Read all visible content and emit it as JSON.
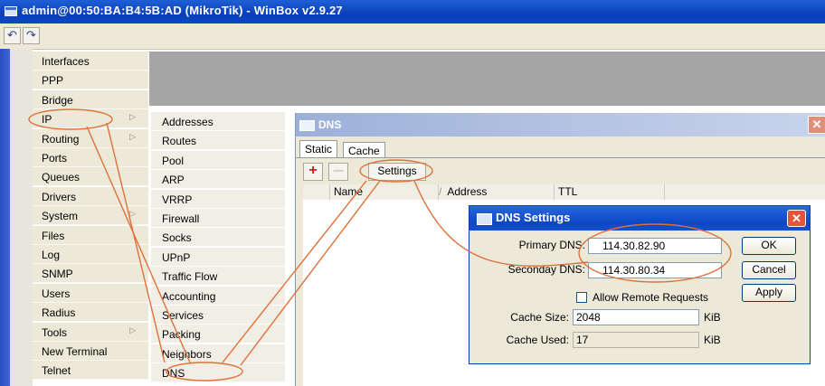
{
  "window": {
    "title": "admin@00:50:BA:B4:5B:AD (MikroTik) - WinBox v2.9.27"
  },
  "toolbar": {
    "undo_icon": "undo-icon",
    "redo_icon": "redo-icon",
    "undo_glyph": "↶",
    "redo_glyph": "↷"
  },
  "menu": {
    "items": [
      {
        "label": "Interfaces"
      },
      {
        "label": "PPP"
      },
      {
        "label": "Bridge"
      },
      {
        "label": "IP",
        "arrow": "▷"
      },
      {
        "label": "Routing",
        "arrow": "▷"
      },
      {
        "label": "Ports"
      },
      {
        "label": "Queues"
      },
      {
        "label": "Drivers"
      },
      {
        "label": "System",
        "arrow": "▷"
      },
      {
        "label": "Files"
      },
      {
        "label": "Log"
      },
      {
        "label": "SNMP"
      },
      {
        "label": "Users"
      },
      {
        "label": "Radius"
      },
      {
        "label": "Tools",
        "arrow": "▷"
      },
      {
        "label": "New Terminal"
      },
      {
        "label": "Telnet"
      }
    ]
  },
  "submenu": {
    "items": [
      {
        "label": "Addresses"
      },
      {
        "label": "Routes"
      },
      {
        "label": "Pool"
      },
      {
        "label": "ARP"
      },
      {
        "label": "VRRP"
      },
      {
        "label": "Firewall"
      },
      {
        "label": "Socks"
      },
      {
        "label": "UPnP"
      },
      {
        "label": "Traffic Flow"
      },
      {
        "label": "Accounting"
      },
      {
        "label": "Services"
      },
      {
        "label": "Packing"
      },
      {
        "label": "Neighbors"
      },
      {
        "label": "DNS"
      }
    ]
  },
  "dns_window": {
    "title": "DNS",
    "close": "✕",
    "tabs": [
      {
        "label": "Static"
      },
      {
        "label": "Cache"
      }
    ],
    "add_glyph": "+",
    "remove_glyph": "—",
    "settings_button": "Settings",
    "columns": [
      "Name",
      "Address",
      "TTL"
    ],
    "sort_glyph": "/"
  },
  "dns_settings": {
    "title": "DNS Settings",
    "close": "✕",
    "primary_label": "Primary DNS:",
    "primary_value": "114.30.82.90",
    "secondary_label": "Seconday DNS:",
    "secondary_value": "114.30.80.34",
    "allow_remote_label": "Allow Remote Requests",
    "cache_size_label": "Cache Size:",
    "cache_size_value": "2048",
    "cache_size_unit": "KiB",
    "cache_used_label": "Cache Used:",
    "cache_used_value": "17",
    "cache_used_unit": "KiB",
    "check_glyph": "✓",
    "ok_button": "OK",
    "cancel_button": "Cancel",
    "apply_button": "Apply"
  },
  "colors": {
    "annotation": "#e0703a"
  }
}
